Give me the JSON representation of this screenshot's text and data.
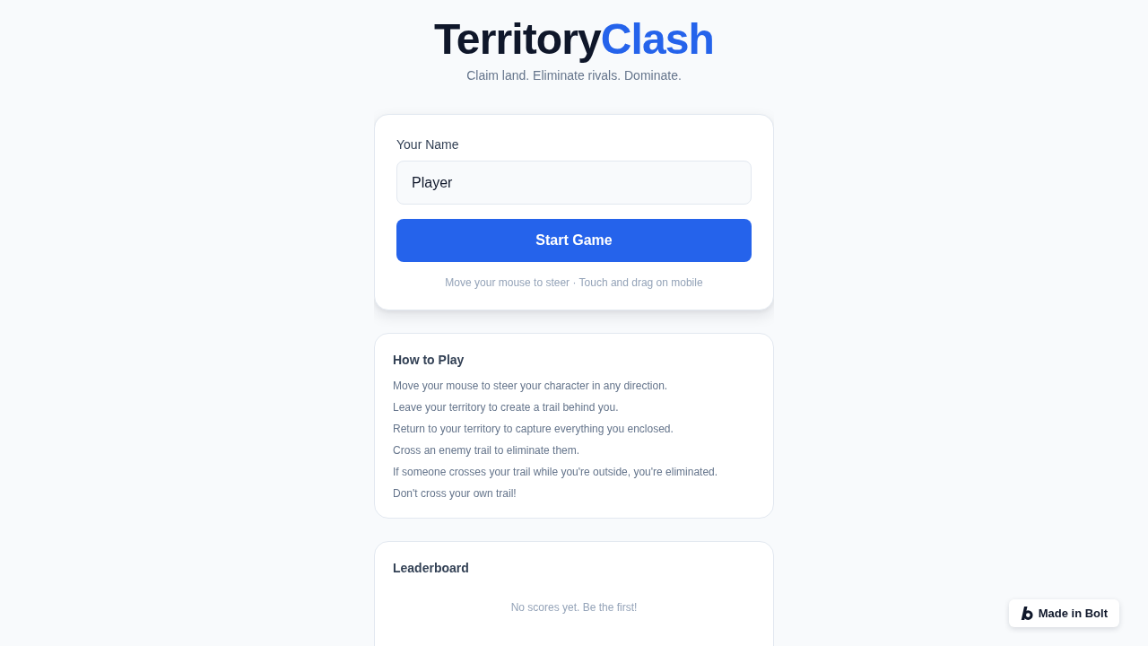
{
  "header": {
    "title_main": "Territory",
    "title_accent": "Clash",
    "tagline": "Claim land. Eliminate rivals. Dominate."
  },
  "name_form": {
    "label": "Your Name",
    "name_field": {
      "value": "Player"
    },
    "start_button": "Start Game",
    "hint": "Move your mouse to steer · Touch and drag on mobile"
  },
  "how_to_play": {
    "title": "How to Play",
    "rules": [
      "Move your mouse to steer your character in any direction.",
      "Leave your territory to create a trail behind you.",
      "Return to your territory to capture everything you enclosed.",
      "Cross an enemy trail to eliminate them.",
      "If someone crosses your trail while you're outside, you're eliminated.",
      "Don't cross your own trail!"
    ]
  },
  "leaderboard": {
    "title": "Leaderboard",
    "empty_message": "No scores yet. Be the first!"
  },
  "badge": {
    "label": "Made in Bolt"
  }
}
